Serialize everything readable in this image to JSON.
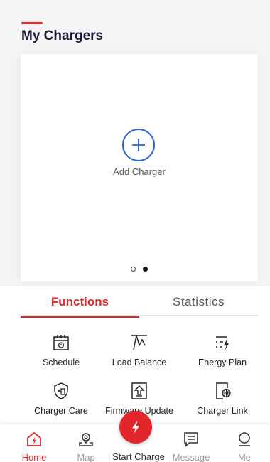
{
  "header": {
    "title": "My Chargers"
  },
  "card": {
    "add_label": "Add Charger",
    "pager_total": 2,
    "pager_active": 2
  },
  "tabs": {
    "functions": "Functions",
    "statistics": "Statistics",
    "active": "Functions"
  },
  "functions": [
    {
      "label": "Schedule",
      "icon": "calendar-clock-icon"
    },
    {
      "label": "Load Balance",
      "icon": "load-balance-icon"
    },
    {
      "label": "Energy Plan",
      "icon": "energy-plan-icon"
    },
    {
      "label": "Charger Care",
      "icon": "shield-charger-icon"
    },
    {
      "label": "Firmware Update",
      "icon": "firmware-update-icon"
    },
    {
      "label": "Charger Link",
      "icon": "charger-link-icon"
    }
  ],
  "nav": {
    "home": "Home",
    "map": "Map",
    "start_charge": "Start Charge",
    "message": "Message",
    "me": "Me",
    "active": "Home"
  },
  "colors": {
    "accent": "#e3262b",
    "primary_blue": "#2a63d4",
    "title": "#1b1c3a"
  }
}
